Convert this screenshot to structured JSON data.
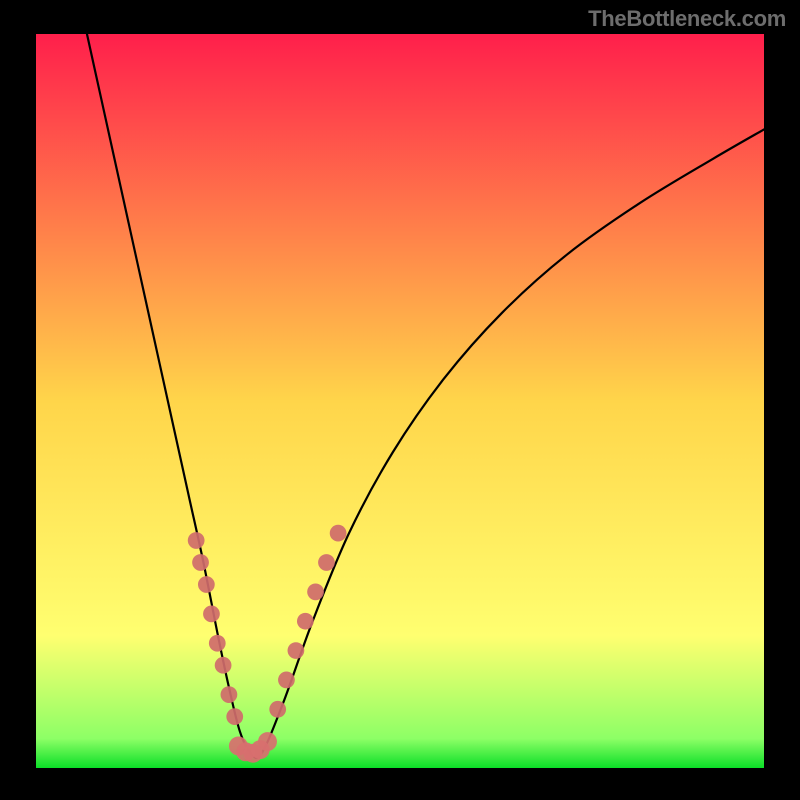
{
  "watermark": "TheBottleneck.com",
  "chart_data": {
    "type": "line",
    "title": "",
    "xlabel": "",
    "ylabel": "",
    "xlim": [
      0,
      100
    ],
    "ylim": [
      0,
      100
    ],
    "background_gradient": {
      "stops": [
        {
          "offset": 0,
          "color": "#ff1f4b"
        },
        {
          "offset": 50,
          "color": "#ffd54a"
        },
        {
          "offset": 82,
          "color": "#ffff70"
        },
        {
          "offset": 96,
          "color": "#8dff66"
        },
        {
          "offset": 100,
          "color": "#0bdf27"
        }
      ]
    },
    "series": [
      {
        "name": "bottleneck-curve",
        "color": "#000000",
        "x": [
          7,
          9,
          11,
          13,
          15,
          17,
          19,
          21,
          23,
          25,
          26.5,
          28,
          29.5,
          31,
          34,
          38,
          43,
          49,
          56,
          64,
          73,
          83,
          93,
          100
        ],
        "y": [
          100,
          91,
          82,
          73,
          64,
          55,
          46,
          37,
          28,
          18,
          11,
          5,
          2,
          2,
          9,
          20,
          32,
          43,
          53,
          62,
          70,
          77,
          83,
          87
        ]
      }
    ],
    "scatter": [
      {
        "name": "left-cluster",
        "color": "#cf6b6b",
        "radius": 1.15,
        "points": [
          {
            "x": 22.0,
            "y": 31
          },
          {
            "x": 22.6,
            "y": 28
          },
          {
            "x": 23.4,
            "y": 25
          },
          {
            "x": 24.1,
            "y": 21
          },
          {
            "x": 24.9,
            "y": 17
          },
          {
            "x": 25.7,
            "y": 14
          },
          {
            "x": 26.5,
            "y": 10
          },
          {
            "x": 27.3,
            "y": 7
          }
        ]
      },
      {
        "name": "valley-cluster",
        "color": "#d86f6f",
        "radius": 1.3,
        "points": [
          {
            "x": 27.8,
            "y": 3.0
          },
          {
            "x": 28.8,
            "y": 2.2
          },
          {
            "x": 29.8,
            "y": 2.0
          },
          {
            "x": 30.8,
            "y": 2.5
          },
          {
            "x": 31.8,
            "y": 3.6
          }
        ]
      },
      {
        "name": "right-cluster",
        "color": "#cf6b6b",
        "radius": 1.15,
        "points": [
          {
            "x": 33.2,
            "y": 8
          },
          {
            "x": 34.4,
            "y": 12
          },
          {
            "x": 35.7,
            "y": 16
          },
          {
            "x": 37.0,
            "y": 20
          },
          {
            "x": 38.4,
            "y": 24
          },
          {
            "x": 39.9,
            "y": 28
          },
          {
            "x": 41.5,
            "y": 32
          }
        ]
      }
    ]
  }
}
